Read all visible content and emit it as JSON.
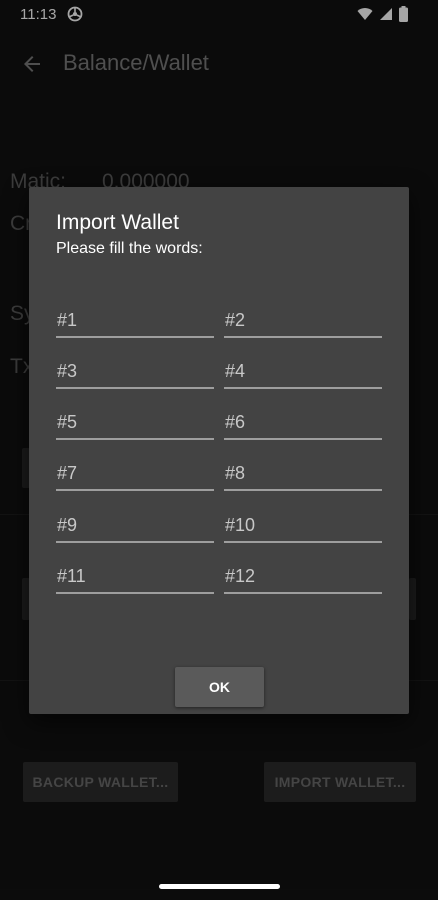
{
  "status_bar": {
    "time": "11:13",
    "icons": [
      "vpn-icon",
      "wifi-icon",
      "signal-icon",
      "battery-icon"
    ]
  },
  "app_bar": {
    "title": "Balance/Wallet",
    "back_icon": "arrow-back-icon"
  },
  "background": {
    "matic_label": "Matic:",
    "matic_value": "0.000000",
    "line2_partial": "Cr",
    "line3_partial": "Sy",
    "line4_partial": "Tx",
    "backup_button_label": "BACKUP WALLET...",
    "import_button_label": "IMPORT WALLET..."
  },
  "dialog": {
    "title": "Import Wallet",
    "subtitle": "Please fill the words:",
    "word_placeholders": [
      "#1",
      "#2",
      "#3",
      "#4",
      "#5",
      "#6",
      "#7",
      "#8",
      "#9",
      "#10",
      "#11",
      "#12"
    ],
    "ok_label": "OK"
  },
  "colors": {
    "background": "#121212",
    "dialog": "#434343",
    "field_underline": "#9e9e9e",
    "ok_button": "#5a5a5a"
  }
}
